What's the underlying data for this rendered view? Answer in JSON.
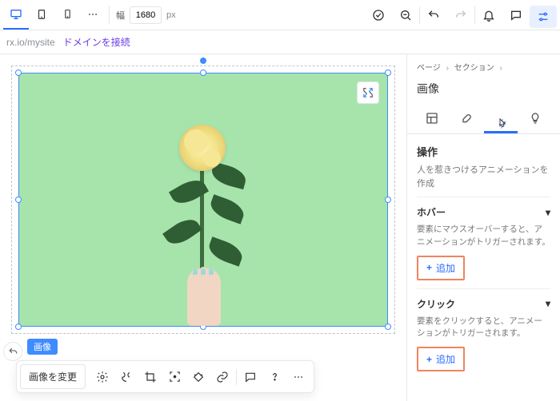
{
  "topbar": {
    "width_label": "幅",
    "width_value": "1680",
    "width_unit": "px"
  },
  "urlbar": {
    "host": "rx.io/mysite",
    "connect": "ドメインを接続"
  },
  "canvas_toolbar": {
    "change_image": "画像を変更"
  },
  "canvas_tag": "画像",
  "sidebar": {
    "crumbs": [
      "ページ",
      "セクション"
    ],
    "title": "画像",
    "panel": {
      "heading": "操作",
      "sub": "人を惹きつけるアニメーションを作成"
    },
    "sections": [
      {
        "title": "ホバー",
        "desc": "要素にマウスオーバーすると、アニメーションがトリガーされます。",
        "add": "追加"
      },
      {
        "title": "クリック",
        "desc": "要素をクリックすると、アニメーションがトリガーされます。",
        "add": "追加"
      }
    ]
  }
}
